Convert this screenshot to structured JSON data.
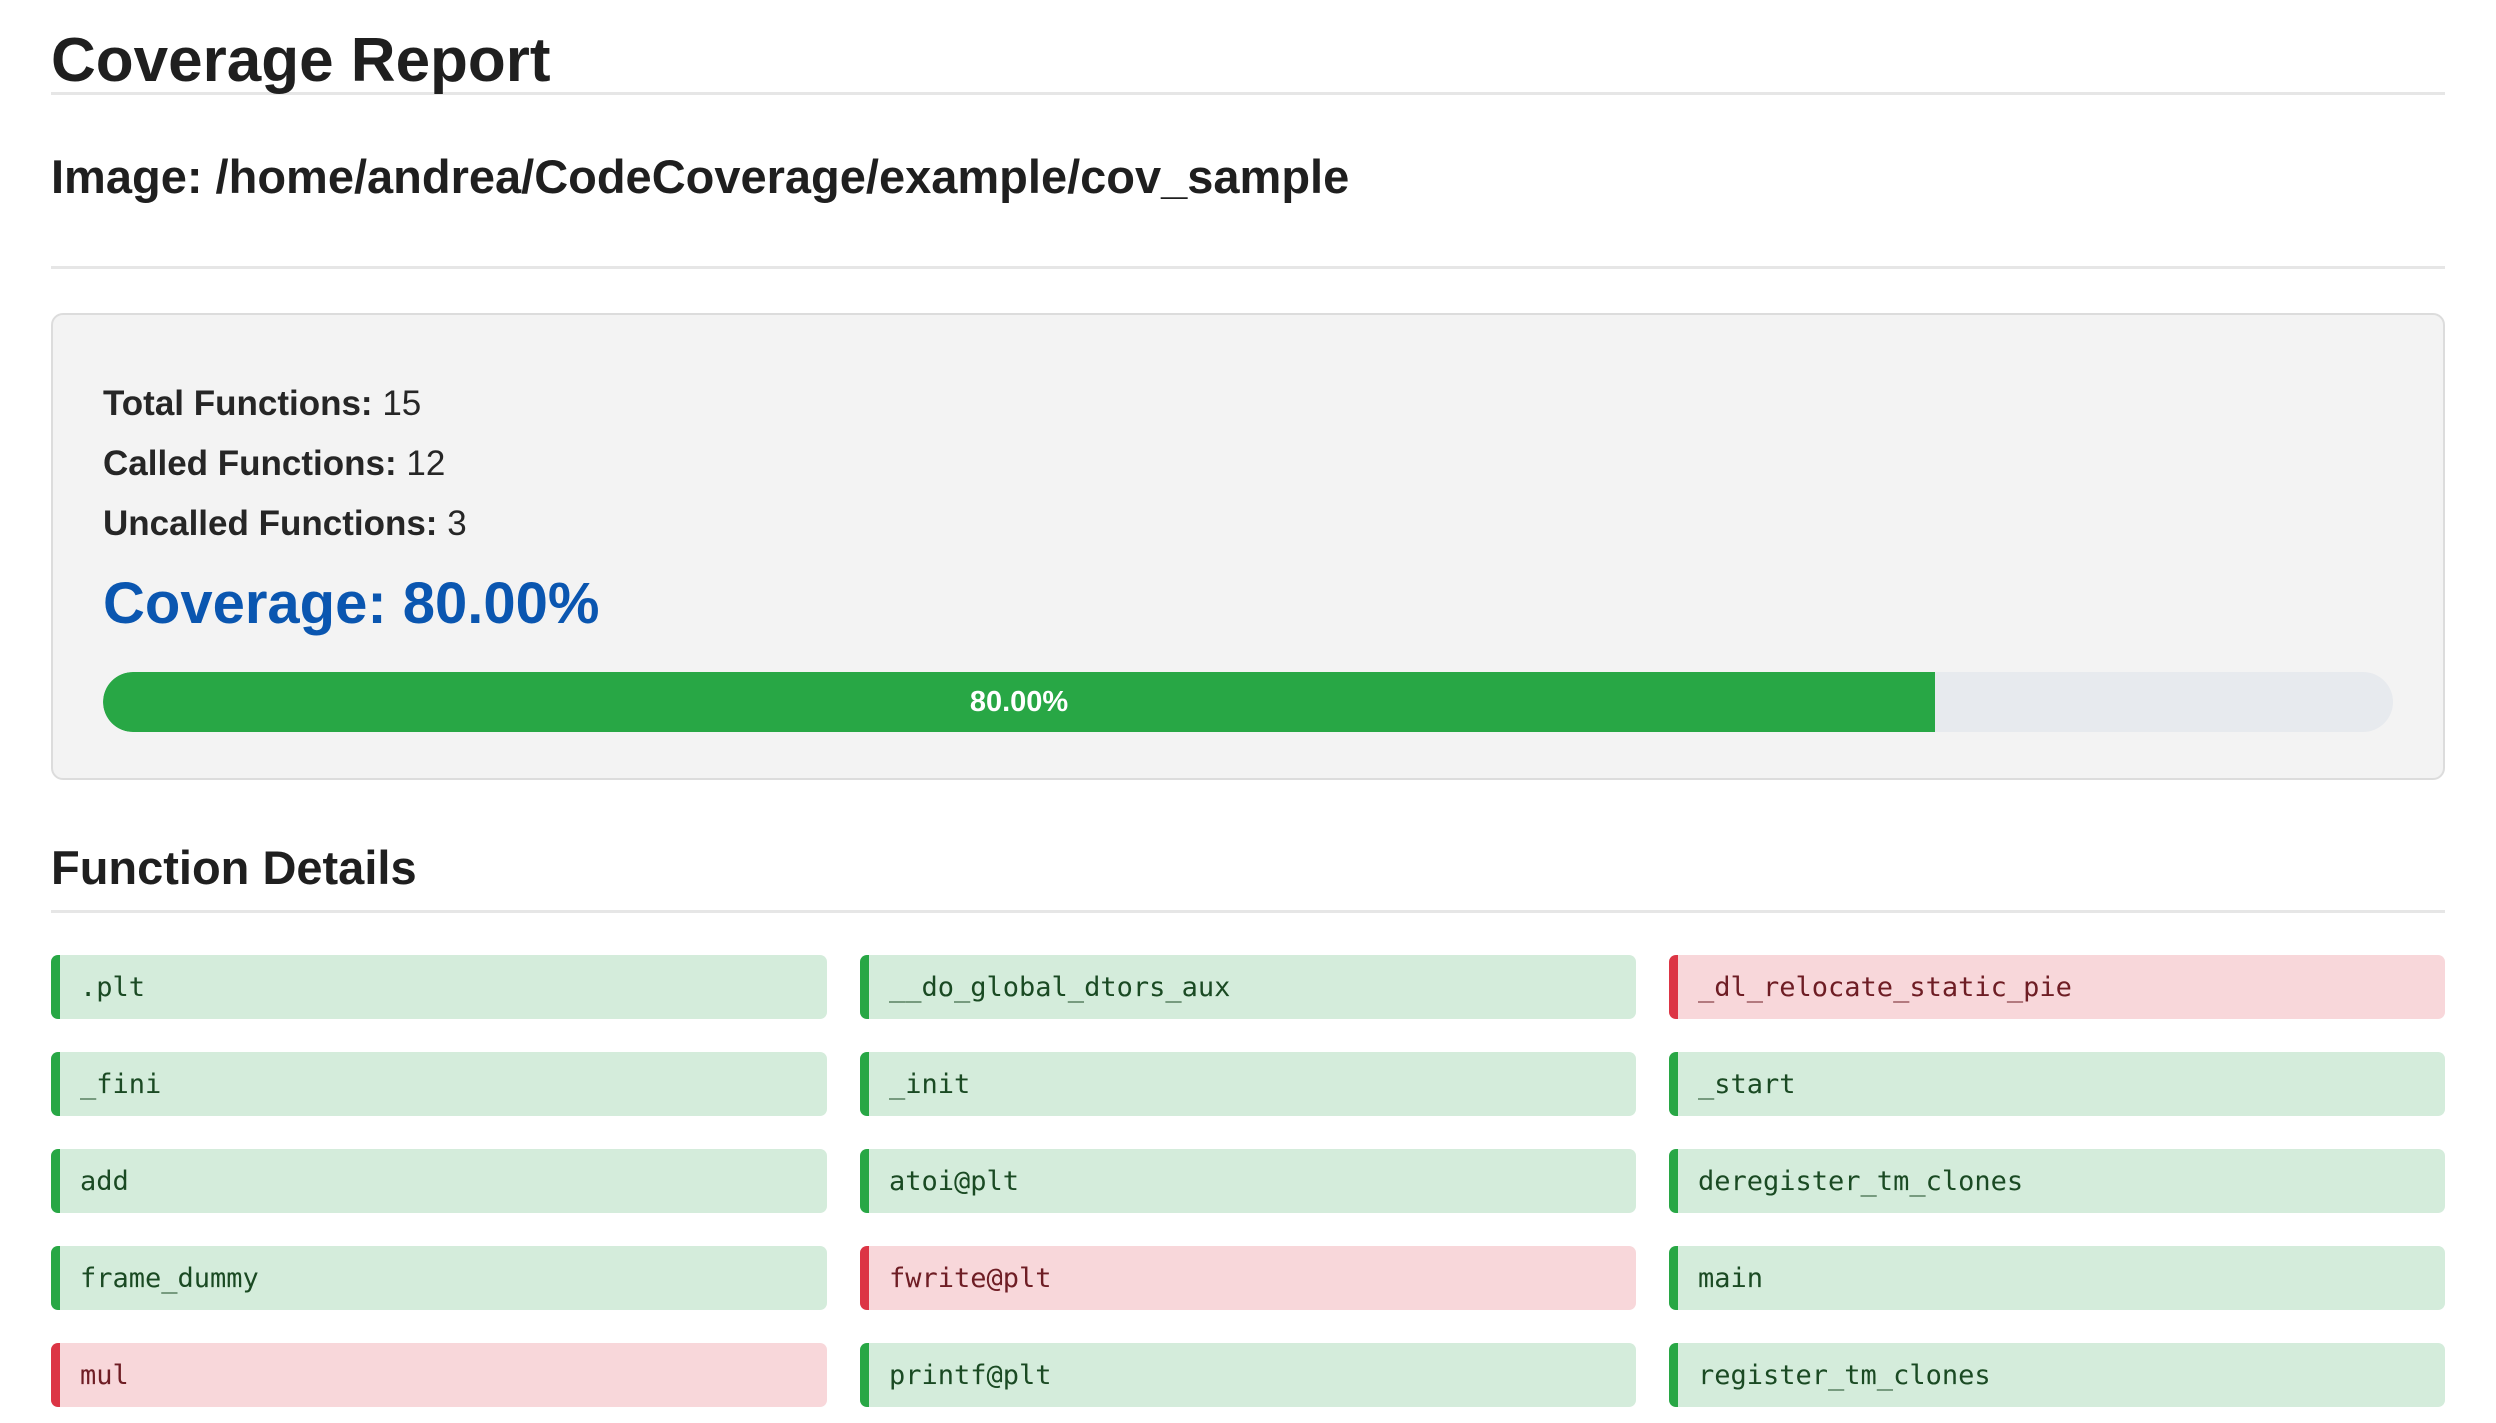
{
  "header": {
    "title": "Coverage Report",
    "image_label": "Image: /home/andrea/CodeCoverage/example/cov_sample"
  },
  "summary": {
    "total_label": "Total Functions:",
    "total_value": "15",
    "called_label": "Called Functions:",
    "called_value": "12",
    "uncalled_label": "Uncalled Functions:",
    "uncalled_value": "3",
    "coverage_text": "Coverage: 80.00%",
    "progress_label": "80.00%",
    "progress_fraction": 0.8
  },
  "details": {
    "heading": "Function Details",
    "functions": [
      {
        "name": ".plt",
        "status": "called"
      },
      {
        "name": "__do_global_dtors_aux",
        "status": "called"
      },
      {
        "name": "_dl_relocate_static_pie",
        "status": "uncalled"
      },
      {
        "name": "_fini",
        "status": "called"
      },
      {
        "name": "_init",
        "status": "called"
      },
      {
        "name": "_start",
        "status": "called"
      },
      {
        "name": "add",
        "status": "called"
      },
      {
        "name": "atoi@plt",
        "status": "called"
      },
      {
        "name": "deregister_tm_clones",
        "status": "called"
      },
      {
        "name": "frame_dummy",
        "status": "called"
      },
      {
        "name": "fwrite@plt",
        "status": "uncalled"
      },
      {
        "name": "main",
        "status": "called"
      },
      {
        "name": "mul",
        "status": "uncalled"
      },
      {
        "name": "printf@plt",
        "status": "called"
      },
      {
        "name": "register_tm_clones",
        "status": "called"
      }
    ]
  },
  "colors": {
    "called_bg": "#d4ecdb",
    "called_border": "#28a745",
    "uncalled_bg": "#f8d7da",
    "uncalled_border": "#dc3545",
    "coverage_text": "#0a56b0",
    "progress_fill": "#28a745"
  }
}
